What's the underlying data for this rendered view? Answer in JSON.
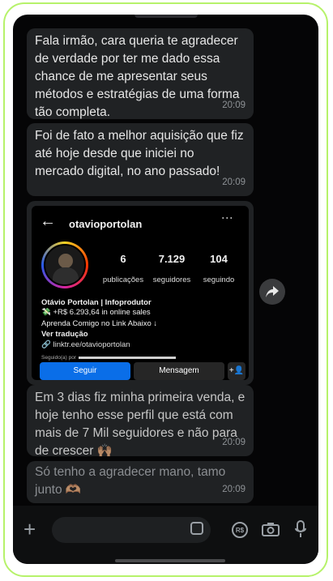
{
  "messages": [
    {
      "text": "Fala irmão, cara queria te agradecer de verdade por ter me dado essa chance de me apresentar seus métodos e estratégias de uma forma tão completa.",
      "time": "20:09"
    },
    {
      "text": "Foi de fato a melhor aquisição que fiz até hoje desde que iniciei no mercado digital, no ano passado!",
      "time": "20:09"
    },
    {
      "text": "Em 3 dias fiz minha primeira venda, e hoje tenho esse perfil que está com mais de 7 Mil seguidores e não para de crescer 🙌🏽",
      "time": "20:09"
    },
    {
      "text": "Só tenho a agradecer mano, tamo junto 🫶🏽",
      "time": "20:09"
    }
  ],
  "profile": {
    "back_icon": "←",
    "username": "otavioportolan",
    "more_icon": "⋮",
    "stats": [
      {
        "value": "6",
        "label": "publicações"
      },
      {
        "value": "7.129",
        "label": "seguidores"
      },
      {
        "value": "104",
        "label": "seguindo"
      }
    ],
    "name": "Otávio Portolan | Infoprodutor",
    "sales": "💸 +R$ 6.293,64 in online sales",
    "bio": "Aprenda Comigo no Link Abaixo ↓",
    "translate": "Ver tradução",
    "link": "🔗 linktr.ee/otavioportolan",
    "followed_by": "Seguido(a) por",
    "follow_button": "Seguir",
    "message_button": "Mensagem",
    "add_person_icon": "+👤"
  },
  "composer": {
    "plus_icon": "+",
    "pay_icon": "R$"
  },
  "colors": {
    "background": "#050506",
    "bubble": "#202224",
    "follow_blue": "#0a6ee8",
    "frame_green": "#b6f26a"
  }
}
